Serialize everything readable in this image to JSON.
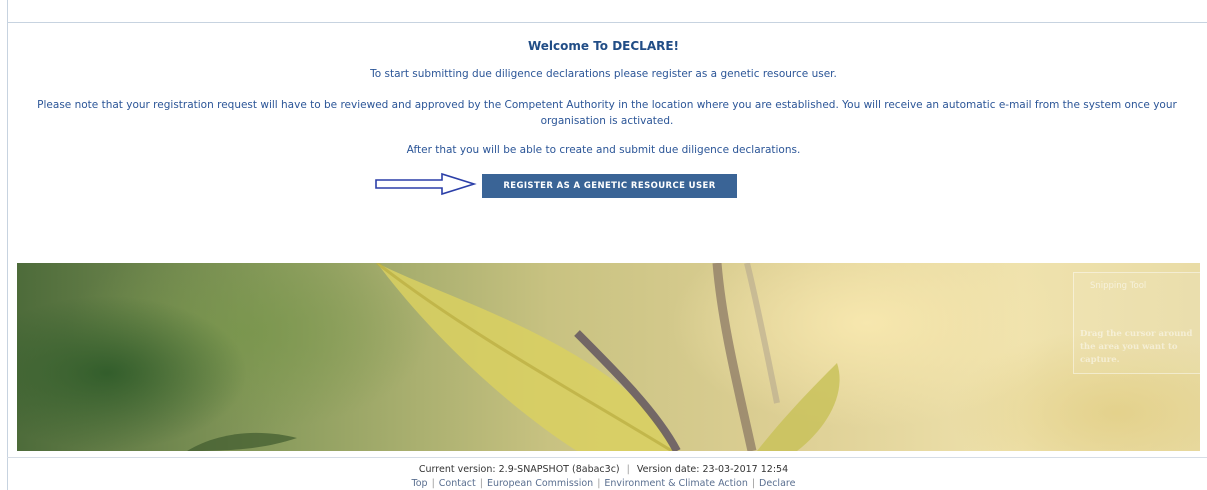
{
  "main": {
    "welcome_title": "Welcome To DECLARE!",
    "intro_text": "To start submitting due diligence declarations please register as a genetic resource user.",
    "note_text": "Please note that your registration request will have to be reviewed and approved by the Competent Authority in the location where you are established. You will receive an automatic e-mail from the system once your organisation is activated.",
    "after_text": "After that you will be able to create and submit due diligence declarations.",
    "register_button_label": "REGISTER AS A GENETIC RESOURCE USER"
  },
  "overlay": {
    "snipping_title": "Snipping Tool",
    "snipping_text": "Drag the cursor around the area you want to capture."
  },
  "footer": {
    "version_label": "Current version:",
    "version_value": "2.9-SNAPSHOT (8abac3c)",
    "version_date_label": "Version date:",
    "version_date_value": "23-03-2017 12:54",
    "links": [
      "Top",
      "Contact",
      "European Commission",
      "Environment & Climate Action",
      "Declare"
    ]
  },
  "colors": {
    "accent_text": "#2b5597",
    "button_bg": "#3a6496",
    "arrow": "#2b3fa8"
  }
}
